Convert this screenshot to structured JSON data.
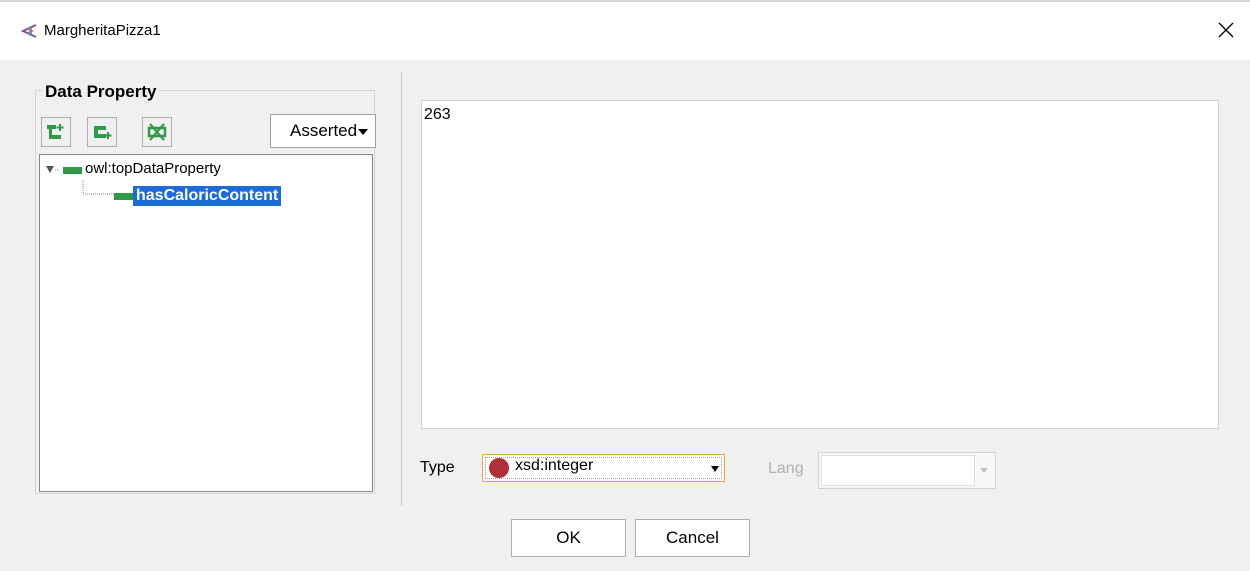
{
  "window": {
    "title": "MargheritaPizza1"
  },
  "left_panel": {
    "group_title": "Data Property",
    "toolbar": {
      "add_sub_icon": "add-subproperty-icon",
      "add_sibling_icon": "add-sibling-icon",
      "delete_icon": "delete-property-icon"
    },
    "mode_dropdown": {
      "selected": "Asserted"
    },
    "tree": {
      "root": "owl:topDataProperty",
      "children": [
        {
          "label": "hasCaloricContent",
          "selected": true
        }
      ]
    }
  },
  "editor": {
    "value": "263",
    "type_label": "Type",
    "type_value": "xsd:integer",
    "lang_label": "Lang",
    "lang_value": ""
  },
  "buttons": {
    "ok": "OK",
    "cancel": "Cancel"
  },
  "colors": {
    "accent_selected": "#1c6bd8",
    "property_green": "#2e9a46",
    "datatype_dot": "#b0303a"
  }
}
